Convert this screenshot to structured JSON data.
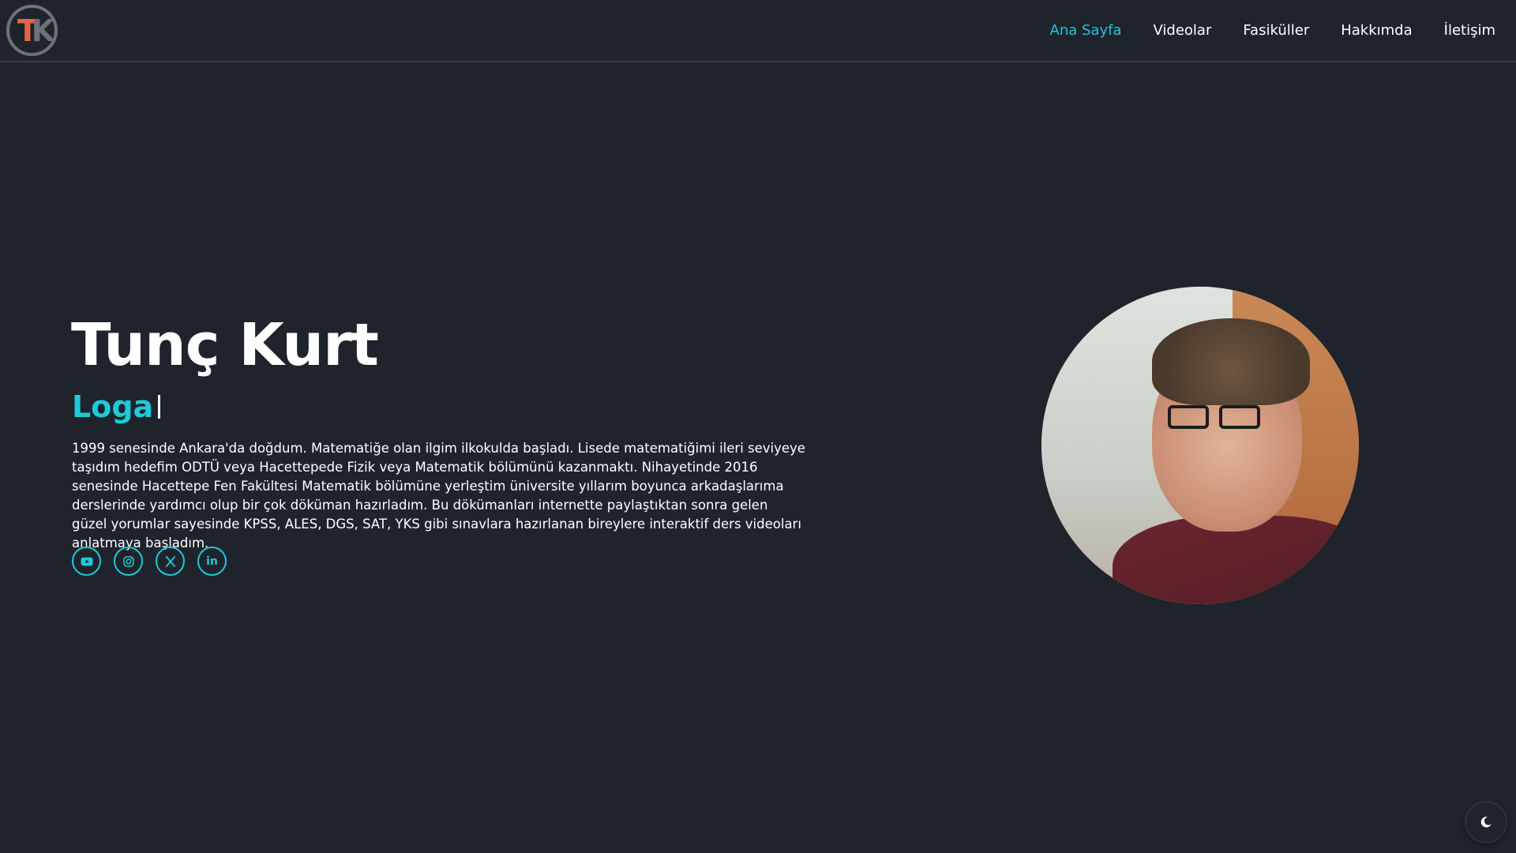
{
  "header": {
    "logo_text": "TK",
    "nav": [
      {
        "label": "Ana Sayfa",
        "active": true
      },
      {
        "label": "Videolar",
        "active": false
      },
      {
        "label": "Fasiküller",
        "active": false
      },
      {
        "label": "Hakkımda",
        "active": false
      },
      {
        "label": "İletişim",
        "active": false
      }
    ]
  },
  "hero": {
    "name": "Tunç Kurt",
    "role_typed": "Loga",
    "bio": "1999 senesinde Ankara'da doğdum. Matematiğe olan ilgim ilkokulda başladı. Lisede matematiğimi ileri seviyeye taşıdım hedefim ODTÜ veya Hacettepede Fizik veya Matematik bölümünü kazanmaktı. Nihayetinde 2016 senesinde Hacettepe Fen Fakültesi Matematik bölümüne yerleştim üniversite yıllarım boyunca arkadaşlarıma derslerinde yardımcı olup bir çok döküman hazırladım. Bu dökümanları internette paylaştıktan sonra gelen güzel yorumlar sayesinde KPSS, ALES, DGS, SAT, YKS gibi sınavlara hazırlanan bireylere interaktif ders videoları anlatmaya başladım.",
    "socials": [
      {
        "icon": "youtube-icon"
      },
      {
        "icon": "instagram-icon"
      },
      {
        "icon": "x-icon"
      },
      {
        "icon": "linkedin-icon",
        "label": "in"
      }
    ]
  },
  "theme_toggle": {
    "icon": "moon-icon"
  },
  "colors": {
    "background": "#1f232c",
    "accent": "#1ecad8",
    "logo_accent": "#e8624a"
  }
}
